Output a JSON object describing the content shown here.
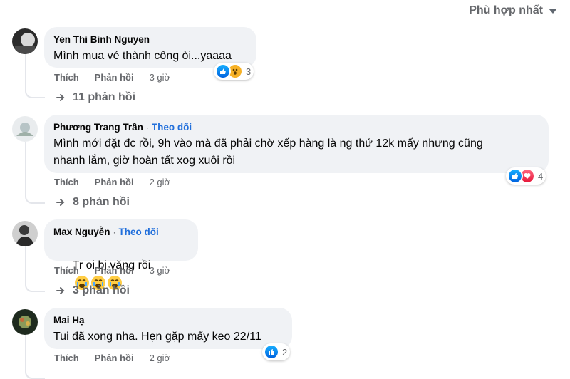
{
  "sort_label": "Phù hợp nhất",
  "comments": [
    {
      "name": "Yen Thi Binh Nguyen",
      "follow": "",
      "text": "Mình mua vé thành công òi...yaaaa",
      "like": "Thích",
      "reply": "Phản hồi",
      "time": "3 giờ",
      "reaction_count": "3",
      "replies": "11 phản hồi"
    },
    {
      "name": "Phương Trang Trần",
      "follow": "Theo dõi",
      "text": "Mình mới đặt đc rồi, 9h vào mà đã phải chờ xếp hàng là ng thứ 12k mấy nhưng cũng\nnhanh lắm, giờ hoàn tất xog xuôi rồi",
      "like": "Thích",
      "reply": "Phản hồi",
      "time": "2 giờ",
      "reaction_count": "4",
      "replies": "8 phản hồi"
    },
    {
      "name": "Max Nguyễn",
      "follow": "Theo dõi",
      "text": "Tr oi bị văng rồi",
      "like": "Thích",
      "reply": "Phản hồi",
      "time": "3 giờ",
      "reaction_count": "",
      "replies": "3 phản hồi"
    },
    {
      "name": "Mai Hạ",
      "follow": "",
      "text": "Tui đã xong nha. Hẹn gặp mấy keo 22/11",
      "like": "Thích",
      "reply": "Phản hồi",
      "time": "2 giờ",
      "reaction_count": "2",
      "replies": ""
    }
  ],
  "colors": {
    "follow": "#216fdb",
    "bubble": "#f0f2f5",
    "meta": "#65676b"
  }
}
